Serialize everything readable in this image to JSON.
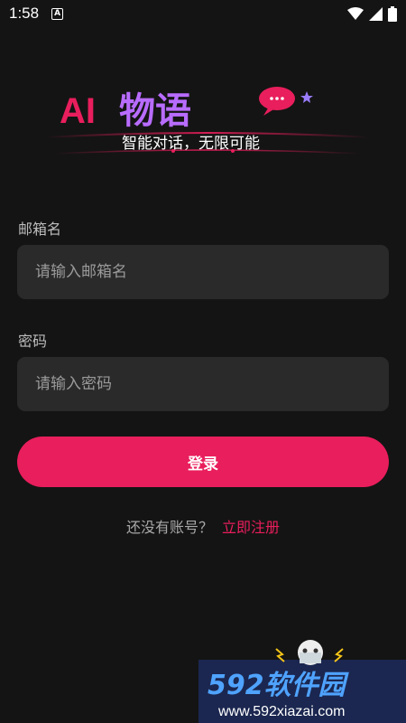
{
  "status_bar": {
    "time": "1:58",
    "notification_icon": "A",
    "icons": [
      "wifi-icon",
      "signal-icon",
      "battery-icon"
    ]
  },
  "logo": {
    "ai_text": "AI",
    "title": "物语",
    "tagline": "智能对话，无限可能",
    "colors": {
      "ai": "#e91e5c",
      "title": "#b86cff",
      "bubble": "#e91e5c"
    }
  },
  "form": {
    "email_label": "邮箱名",
    "email_placeholder": "请输入邮箱名",
    "password_label": "密码",
    "password_placeholder": "请输入密码",
    "login_button": "登录",
    "no_account_text": "还没有账号？",
    "register_link": "立即注册"
  },
  "watermark": {
    "brand": "592软件园",
    "url": "www.592xiazai.com"
  },
  "colors": {
    "background": "#141414",
    "field_background": "#2a2a2a",
    "accent": "#e91e5c"
  }
}
